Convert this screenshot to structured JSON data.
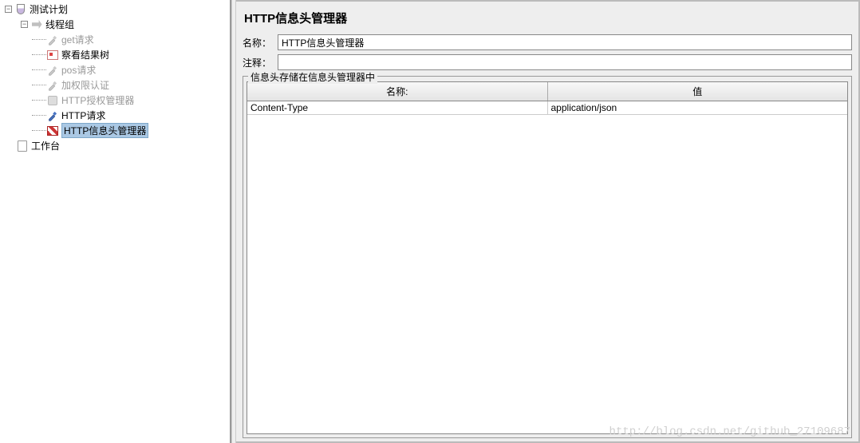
{
  "tree": {
    "root": "测试计划",
    "thread_group": "线程组",
    "items": [
      {
        "label": "get请求",
        "enabled": false
      },
      {
        "label": "察看结果树",
        "enabled": true
      },
      {
        "label": "pos请求",
        "enabled": false
      },
      {
        "label": "加权限认证",
        "enabled": false
      },
      {
        "label": "HTTP授权管理器",
        "enabled": false
      },
      {
        "label": "HTTP请求",
        "enabled": true
      },
      {
        "label": "HTTP信息头管理器",
        "enabled": true,
        "selected": true
      }
    ],
    "workbench": "工作台"
  },
  "panel": {
    "title": "HTTP信息头管理器",
    "name_label": "名称：",
    "name_value": "HTTP信息头管理器",
    "comment_label": "注释：",
    "comment_value": "",
    "fieldset_legend": "信息头存储在信息头管理器中",
    "columns": {
      "name": "名称:",
      "value": "值"
    },
    "rows": [
      {
        "name": "Content-Type",
        "value": "application/json"
      }
    ]
  },
  "watermark": "http://blog.csdn.net/github_27109687"
}
